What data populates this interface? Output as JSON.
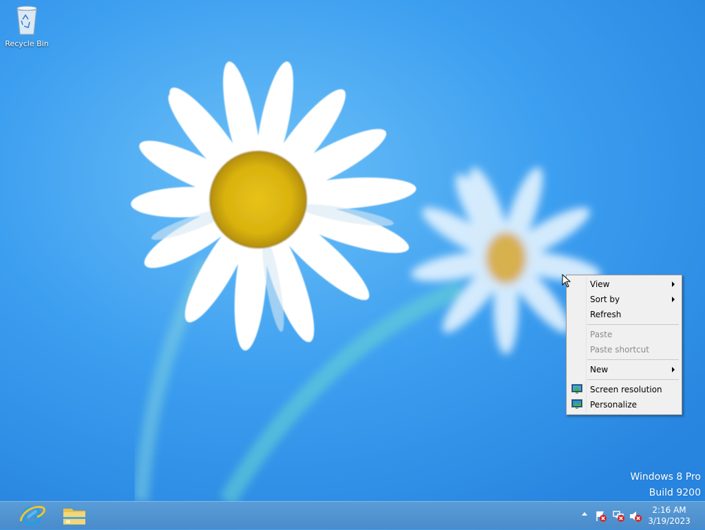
{
  "desktop": {
    "icons": [
      {
        "label": "Recycle Bin",
        "icon": "recycle-bin-icon"
      }
    ],
    "watermark": {
      "edition": "Windows 8 Pro",
      "build": "Build 9200"
    }
  },
  "context_menu": {
    "items": [
      {
        "label": "View",
        "submenu": true,
        "enabled": true
      },
      {
        "label": "Sort by",
        "submenu": true,
        "enabled": true
      },
      {
        "label": "Refresh",
        "submenu": false,
        "enabled": true
      },
      {
        "label": "Paste",
        "submenu": false,
        "enabled": false
      },
      {
        "label": "Paste shortcut",
        "submenu": false,
        "enabled": false
      },
      {
        "label": "New",
        "submenu": true,
        "enabled": true
      },
      {
        "label": "Screen resolution",
        "submenu": false,
        "enabled": true,
        "icon": "screen-resolution-icon"
      },
      {
        "label": "Personalize",
        "submenu": false,
        "enabled": true,
        "icon": "personalize-icon"
      }
    ]
  },
  "taskbar": {
    "pinned": [
      {
        "name": "Internet Explorer",
        "icon": "internet-explorer-icon"
      },
      {
        "name": "File Explorer",
        "icon": "file-explorer-icon"
      }
    ],
    "tray": {
      "icons": [
        "action-center-flag-icon",
        "network-disconnected-icon",
        "volume-muted-icon"
      ],
      "time": "2:16 AM",
      "date": "3/19/2023"
    }
  },
  "colors": {
    "desktop_blue": "#3a9cef",
    "taskbar": "#4a8ccb",
    "menu_bg": "#f0f0f0"
  }
}
